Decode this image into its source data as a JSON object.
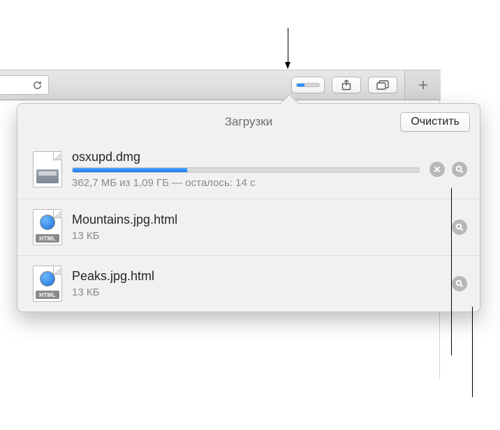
{
  "toolbar": {
    "reload_icon": "reload",
    "downloads_icon": "downloads",
    "downloads_progress_pct": 33,
    "share_icon": "share",
    "tabs_icon": "tabs",
    "newtab_icon": "plus"
  },
  "popover": {
    "title": "Загрузки",
    "clear_label": "Очистить"
  },
  "downloads": [
    {
      "name": "osxupd.dmg",
      "kind": "dmg",
      "status": "362,7 МБ из 1,09 ГБ — осталось: 14 с",
      "progress_pct": 33,
      "has_stop": true,
      "has_reveal": true
    },
    {
      "name": "Mountains.jpg.html",
      "kind": "html",
      "status": "13 КБ",
      "has_stop": false,
      "has_reveal": true
    },
    {
      "name": "Peaks.jpg.html",
      "kind": "html",
      "status": "13 КБ",
      "has_stop": false,
      "has_reveal": true
    }
  ],
  "html_badge_text": "HTML",
  "colors": {
    "accent": "#1a7af5",
    "toolbar_bg": "#dedede",
    "popover_bg": "#f1f1f1",
    "text_secondary": "#8a8a8a"
  }
}
